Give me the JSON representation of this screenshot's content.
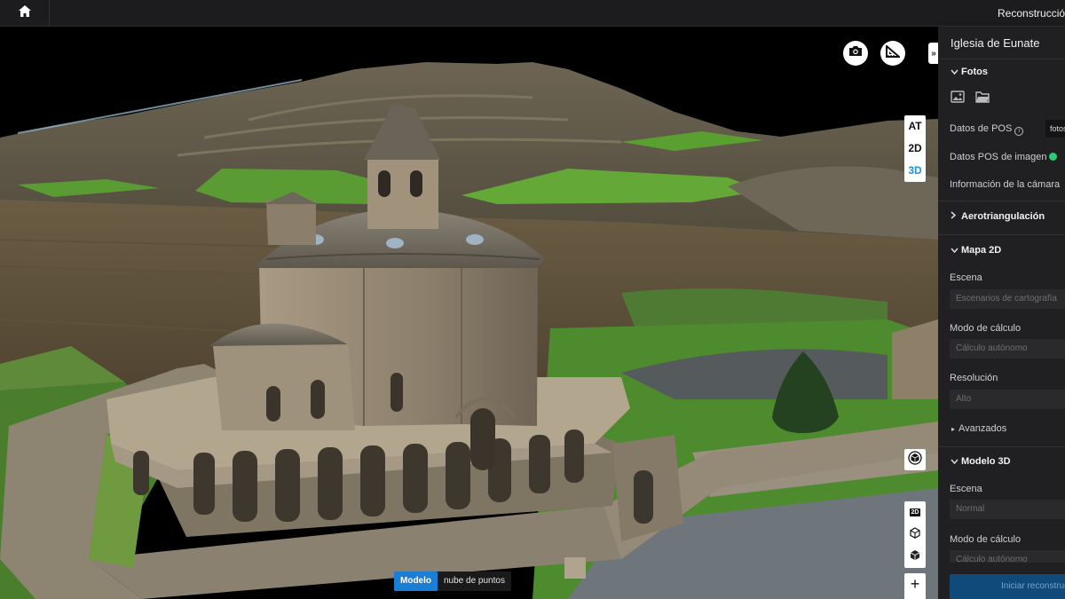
{
  "topbar": {
    "home_icon": "home-icon",
    "title": "Reconstrucción"
  },
  "viewport": {
    "view_modes": [
      "AT",
      "2D",
      "3D"
    ],
    "active_view_mode": "3D",
    "tools": {
      "camera_icon": "camera-icon",
      "measure_icon": "ruler-triangle-icon",
      "collapse_glyph": "»",
      "recenter_icon": "model-focus-icon",
      "stack_icons": [
        "2D",
        "cube-outline-icon",
        "cube-solid-icon"
      ],
      "zoom_in": "+",
      "zoom_out": "−"
    },
    "model_toggle": {
      "options": [
        "Modelo",
        "nube de puntos"
      ],
      "active": "Modelo"
    }
  },
  "panel": {
    "title": "Iglesia de Eunate",
    "fotos": {
      "header": "Fotos",
      "icons": [
        "image-icon",
        "folder-icon"
      ],
      "pos_label": "Datos de POS",
      "pos_button": "fotos",
      "pos_image_label": "Datos POS de imagen",
      "camera_info_label": "Información de la cámara"
    },
    "aerotriangulacion": {
      "header": "Aerotriangulación"
    },
    "mapa2d": {
      "header": "Mapa 2D",
      "escena_label": "Escena",
      "escena_value": "Escenarios de cartografía",
      "modo_label": "Modo de cálculo",
      "modo_value": "Cálculo autónomo",
      "resolucion_label": "Resolución",
      "resolucion_value": "Alto",
      "avanzados": "Avanzados"
    },
    "modelo3d": {
      "header": "Modelo 3D",
      "escena_label": "Escena",
      "escena_value": "Normal",
      "modo_label": "Modo de cálculo",
      "modo_value": "Cálculo autónomo",
      "start_button": "Iniciar reconstrucción"
    }
  },
  "colors": {
    "accent": "#1a7fd4",
    "panel_bg": "#202022",
    "topbar_bg": "#1c1c1e",
    "ok": "#2ecc71"
  }
}
